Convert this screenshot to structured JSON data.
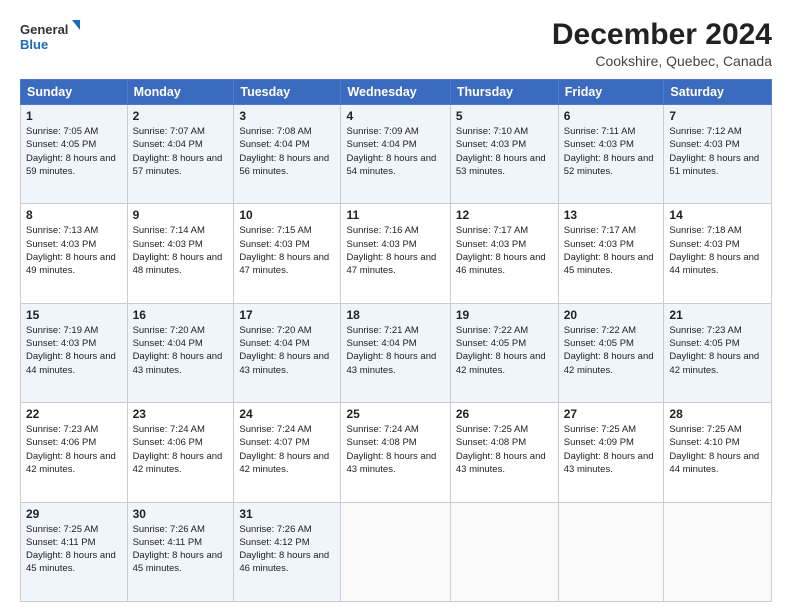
{
  "logo": {
    "line1": "General",
    "line2": "Blue"
  },
  "title": "December 2024",
  "location": "Cookshire, Quebec, Canada",
  "weekdays": [
    "Sunday",
    "Monday",
    "Tuesday",
    "Wednesday",
    "Thursday",
    "Friday",
    "Saturday"
  ],
  "weeks": [
    [
      {
        "day": "1",
        "sunrise": "7:05 AM",
        "sunset": "4:05 PM",
        "daylight": "8 hours and 59 minutes."
      },
      {
        "day": "2",
        "sunrise": "7:07 AM",
        "sunset": "4:04 PM",
        "daylight": "8 hours and 57 minutes."
      },
      {
        "day": "3",
        "sunrise": "7:08 AM",
        "sunset": "4:04 PM",
        "daylight": "8 hours and 56 minutes."
      },
      {
        "day": "4",
        "sunrise": "7:09 AM",
        "sunset": "4:04 PM",
        "daylight": "8 hours and 54 minutes."
      },
      {
        "day": "5",
        "sunrise": "7:10 AM",
        "sunset": "4:03 PM",
        "daylight": "8 hours and 53 minutes."
      },
      {
        "day": "6",
        "sunrise": "7:11 AM",
        "sunset": "4:03 PM",
        "daylight": "8 hours and 52 minutes."
      },
      {
        "day": "7",
        "sunrise": "7:12 AM",
        "sunset": "4:03 PM",
        "daylight": "8 hours and 51 minutes."
      }
    ],
    [
      {
        "day": "8",
        "sunrise": "7:13 AM",
        "sunset": "4:03 PM",
        "daylight": "8 hours and 49 minutes."
      },
      {
        "day": "9",
        "sunrise": "7:14 AM",
        "sunset": "4:03 PM",
        "daylight": "8 hours and 48 minutes."
      },
      {
        "day": "10",
        "sunrise": "7:15 AM",
        "sunset": "4:03 PM",
        "daylight": "8 hours and 47 minutes."
      },
      {
        "day": "11",
        "sunrise": "7:16 AM",
        "sunset": "4:03 PM",
        "daylight": "8 hours and 47 minutes."
      },
      {
        "day": "12",
        "sunrise": "7:17 AM",
        "sunset": "4:03 PM",
        "daylight": "8 hours and 46 minutes."
      },
      {
        "day": "13",
        "sunrise": "7:17 AM",
        "sunset": "4:03 PM",
        "daylight": "8 hours and 45 minutes."
      },
      {
        "day": "14",
        "sunrise": "7:18 AM",
        "sunset": "4:03 PM",
        "daylight": "8 hours and 44 minutes."
      }
    ],
    [
      {
        "day": "15",
        "sunrise": "7:19 AM",
        "sunset": "4:03 PM",
        "daylight": "8 hours and 44 minutes."
      },
      {
        "day": "16",
        "sunrise": "7:20 AM",
        "sunset": "4:04 PM",
        "daylight": "8 hours and 43 minutes."
      },
      {
        "day": "17",
        "sunrise": "7:20 AM",
        "sunset": "4:04 PM",
        "daylight": "8 hours and 43 minutes."
      },
      {
        "day": "18",
        "sunrise": "7:21 AM",
        "sunset": "4:04 PM",
        "daylight": "8 hours and 43 minutes."
      },
      {
        "day": "19",
        "sunrise": "7:22 AM",
        "sunset": "4:05 PM",
        "daylight": "8 hours and 42 minutes."
      },
      {
        "day": "20",
        "sunrise": "7:22 AM",
        "sunset": "4:05 PM",
        "daylight": "8 hours and 42 minutes."
      },
      {
        "day": "21",
        "sunrise": "7:23 AM",
        "sunset": "4:05 PM",
        "daylight": "8 hours and 42 minutes."
      }
    ],
    [
      {
        "day": "22",
        "sunrise": "7:23 AM",
        "sunset": "4:06 PM",
        "daylight": "8 hours and 42 minutes."
      },
      {
        "day": "23",
        "sunrise": "7:24 AM",
        "sunset": "4:06 PM",
        "daylight": "8 hours and 42 minutes."
      },
      {
        "day": "24",
        "sunrise": "7:24 AM",
        "sunset": "4:07 PM",
        "daylight": "8 hours and 42 minutes."
      },
      {
        "day": "25",
        "sunrise": "7:24 AM",
        "sunset": "4:08 PM",
        "daylight": "8 hours and 43 minutes."
      },
      {
        "day": "26",
        "sunrise": "7:25 AM",
        "sunset": "4:08 PM",
        "daylight": "8 hours and 43 minutes."
      },
      {
        "day": "27",
        "sunrise": "7:25 AM",
        "sunset": "4:09 PM",
        "daylight": "8 hours and 43 minutes."
      },
      {
        "day": "28",
        "sunrise": "7:25 AM",
        "sunset": "4:10 PM",
        "daylight": "8 hours and 44 minutes."
      }
    ],
    [
      {
        "day": "29",
        "sunrise": "7:25 AM",
        "sunset": "4:11 PM",
        "daylight": "8 hours and 45 minutes."
      },
      {
        "day": "30",
        "sunrise": "7:26 AM",
        "sunset": "4:11 PM",
        "daylight": "8 hours and 45 minutes."
      },
      {
        "day": "31",
        "sunrise": "7:26 AM",
        "sunset": "4:12 PM",
        "daylight": "8 hours and 46 minutes."
      },
      null,
      null,
      null,
      null
    ]
  ]
}
